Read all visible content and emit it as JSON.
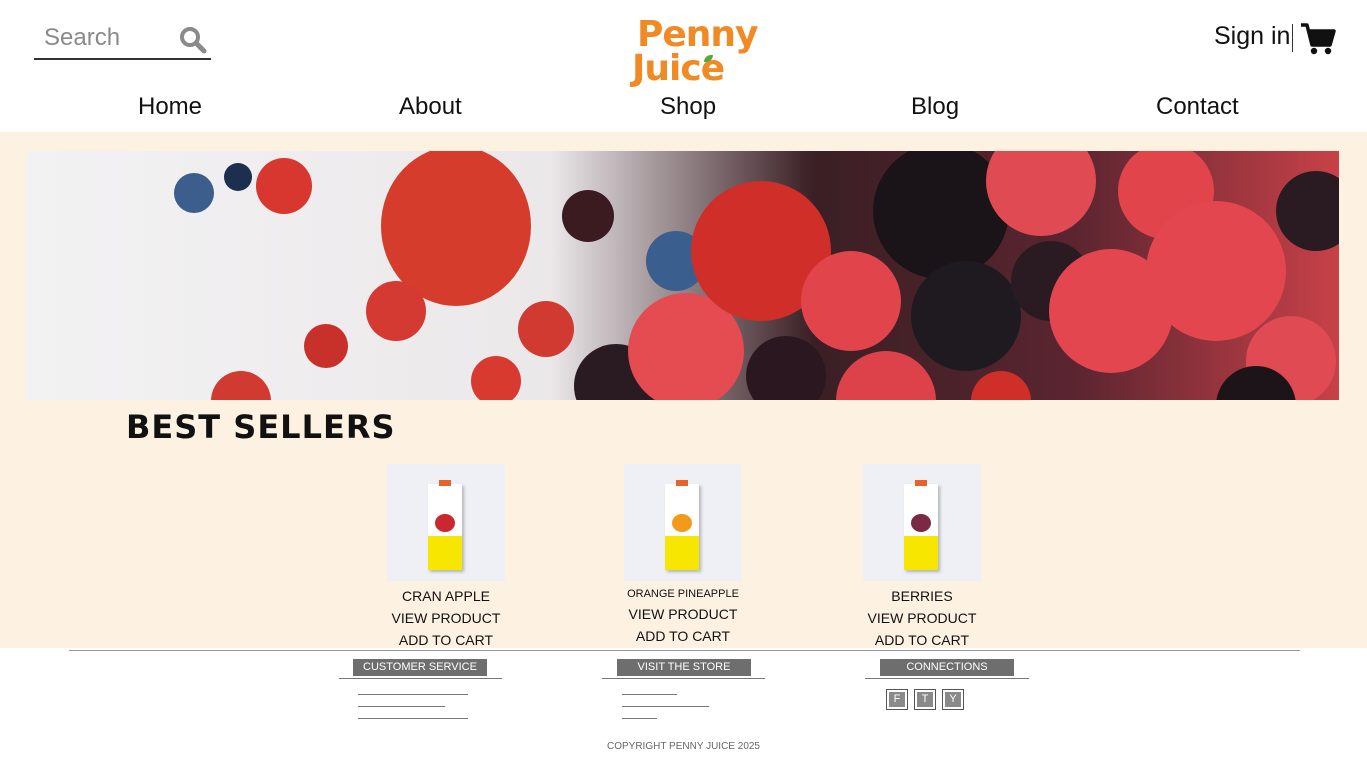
{
  "header": {
    "search_placeholder": "Search",
    "logo_line1": "Penny",
    "logo_line2": "Juice",
    "signin_label": "Sign in",
    "brand_color": "#f08a24"
  },
  "nav": {
    "items": [
      {
        "label": "Home"
      },
      {
        "label": "About"
      },
      {
        "label": "Shop"
      },
      {
        "label": "Blog"
      },
      {
        "label": "Contact"
      }
    ]
  },
  "hero": {
    "image": "mixed-berries-banner"
  },
  "best_sellers": {
    "title": "BEST SELLERS",
    "products": [
      {
        "name": "CRAN APPLE",
        "view": "VIEW PRODUCT",
        "add": "ADD TO CART"
      },
      {
        "name": "ORANGE PINEAPPLE",
        "view": "VIEW PRODUCT",
        "add": "ADD TO CART"
      },
      {
        "name": "BERRIES",
        "view": "VIEW PRODUCT",
        "add": "ADD TO CART"
      }
    ]
  },
  "footer": {
    "headings": {
      "customer_service": "CUSTOMER SERVICE",
      "visit_store": "VISIT THE STORE",
      "connections": "CONNECTIONS"
    },
    "social": [
      "F",
      "T",
      "Y"
    ],
    "copyright": "COPYRIGHT PENNY JUICE 2025"
  },
  "colors": {
    "band_bg": "#fdf2e2",
    "footer_heading_bg": "#6e6e6e"
  }
}
